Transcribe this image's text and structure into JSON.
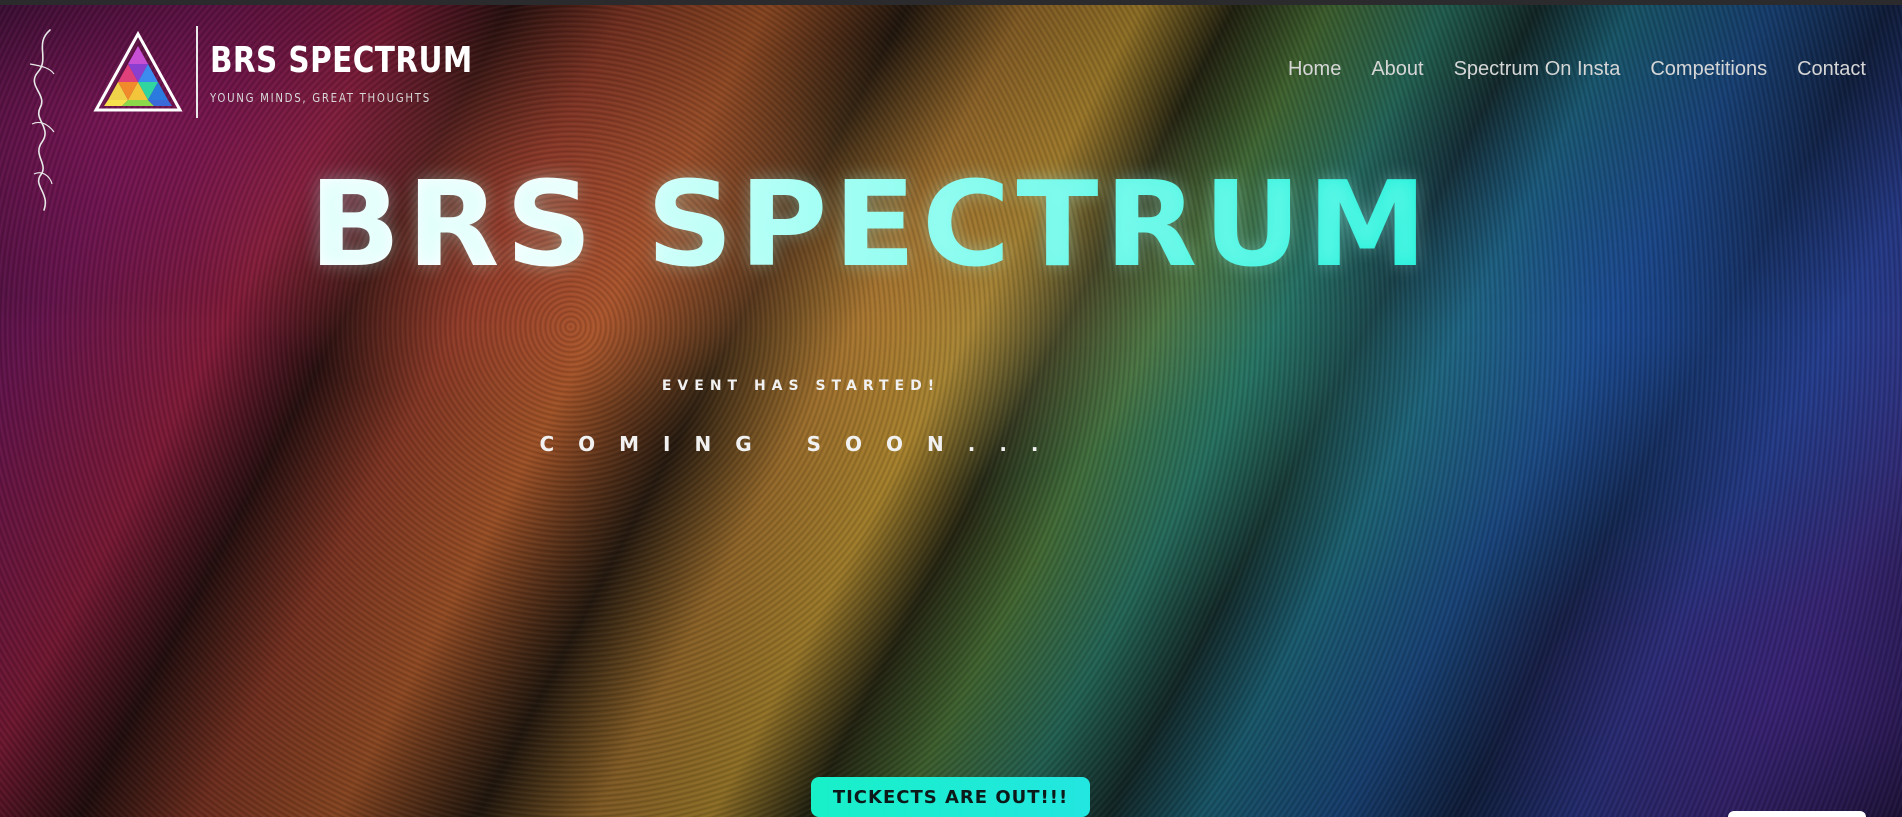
{
  "header": {
    "logo_title": "BRS SPECTRUM",
    "logo_tagline": "YOUNG MINDS, GREAT THOUGHTS",
    "signature": "Aryan R Agarwal"
  },
  "nav": {
    "items": [
      {
        "label": "Home"
      },
      {
        "label": "About"
      },
      {
        "label": "Spectrum On Insta"
      },
      {
        "label": "Competitions"
      },
      {
        "label": "Contact"
      }
    ]
  },
  "hero": {
    "title": "BRS SPECTRUM",
    "event_status": "EVENT HAS STARTED!",
    "coming_soon": "COMING SOON...",
    "cta_label": "TICKECTS ARE OUT!!!"
  },
  "colors": {
    "accent": "#1af0d8",
    "button_bg": "#18f0c8",
    "nav_text": "#d6d6d6"
  },
  "icons": {
    "logo": "rainbow-triangle-logo-icon",
    "signature": "handwritten-signature"
  }
}
